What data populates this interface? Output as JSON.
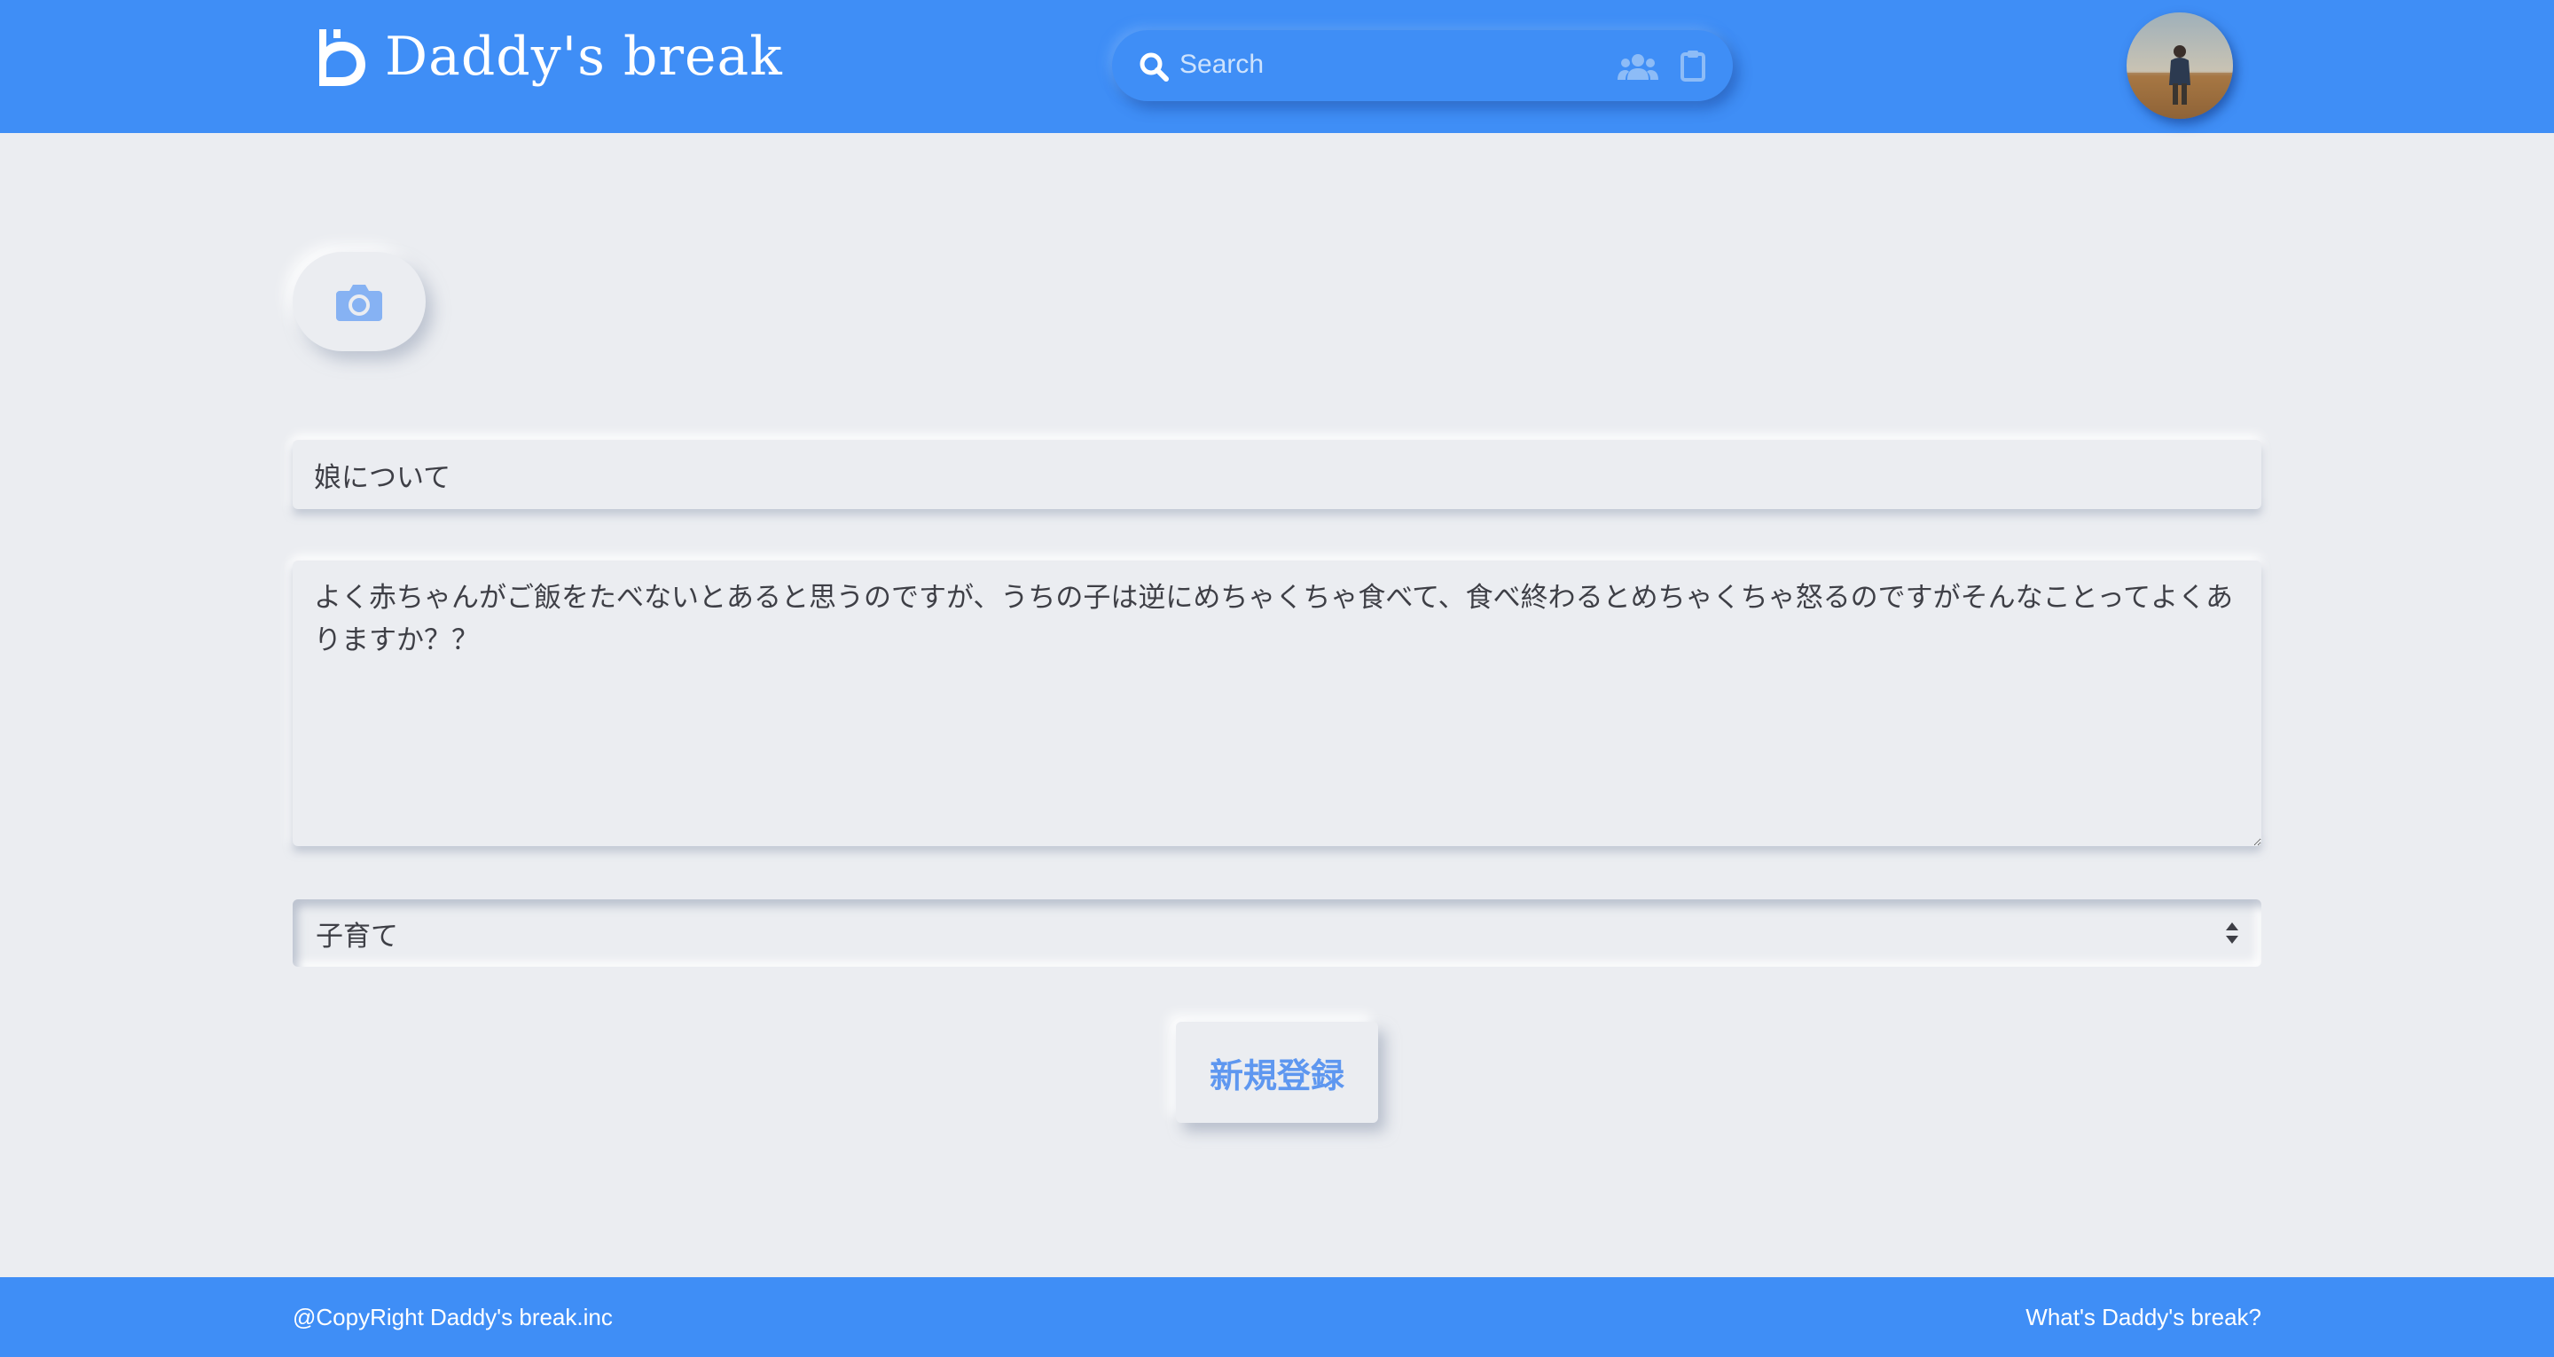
{
  "header": {
    "brand_name": "Daddy's break",
    "search_placeholder": "Search",
    "icons": {
      "logo": "daddys-break-logo",
      "search": "search-icon",
      "users": "users-icon",
      "clipboard": "clipboard-icon"
    },
    "avatar": "user-avatar"
  },
  "form": {
    "camera_icon": "camera-icon",
    "title_value": "娘について",
    "body_value": "よく赤ちゃんがご飯をたべないとあると思うのですが、うちの子は逆にめちゃくちゃ食べて、食べ終わるとめちゃくちゃ怒るのですがそんなことってよくありますか？？",
    "category_value": "子育て",
    "submit_label": "新規登録"
  },
  "footer": {
    "copyright": "@CopyRight Daddy's break.inc",
    "about_link": "What's Daddy's break?"
  },
  "colors": {
    "primary": "#3f8ef6",
    "background": "#ebedf1",
    "button_text": "#5e97f0",
    "text": "#3e3f46"
  }
}
